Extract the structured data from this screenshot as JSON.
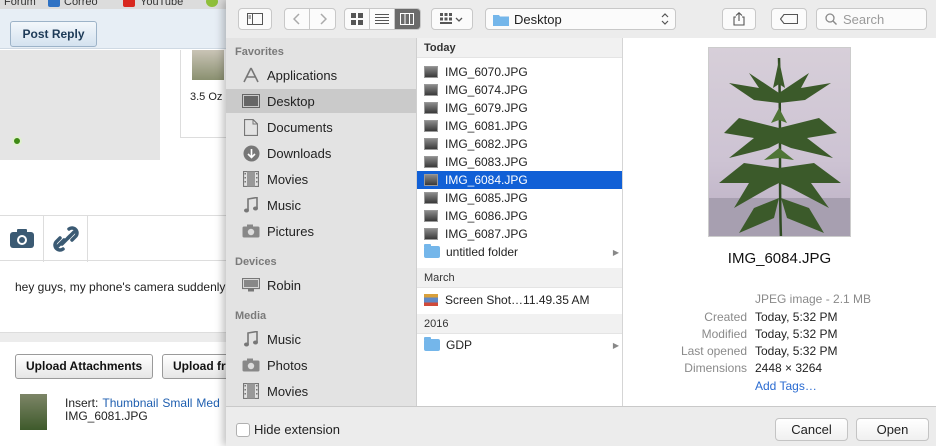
{
  "web": {
    "bookmarks": [
      "Forum",
      "Correo",
      "YouTube"
    ],
    "post_reply_label": "Post Reply",
    "thumb_caption": "3.5 Oz",
    "post_text": "hey guys, my phone's camera suddenly",
    "upload_attachments_label": "Upload Attachments",
    "upload_from_label": "Upload fr",
    "insert_label": "Insert:",
    "insert_links": [
      "Thumbnail",
      "Small",
      "Med"
    ],
    "attachment_name": "IMG_6081.JPG"
  },
  "dialog": {
    "location": "Desktop",
    "search_placeholder": "Search",
    "sidebar": {
      "favorites_header": "Favorites",
      "favorites": [
        {
          "label": "Applications",
          "icon": "applications-icon"
        },
        {
          "label": "Desktop",
          "icon": "desktop-icon",
          "selected": true
        },
        {
          "label": "Documents",
          "icon": "documents-icon"
        },
        {
          "label": "Downloads",
          "icon": "downloads-icon"
        },
        {
          "label": "Movies",
          "icon": "movies-icon"
        },
        {
          "label": "Music",
          "icon": "music-icon"
        },
        {
          "label": "Pictures",
          "icon": "pictures-icon"
        }
      ],
      "devices_header": "Devices",
      "devices": [
        {
          "label": "Robin",
          "icon": "computer-icon"
        }
      ],
      "media_header": "Media",
      "media": [
        {
          "label": "Music",
          "icon": "music-icon"
        },
        {
          "label": "Photos",
          "icon": "photos-icon"
        },
        {
          "label": "Movies",
          "icon": "movies-icon"
        }
      ]
    },
    "column": {
      "today_header": "Today",
      "today_files": [
        "IMG_6070.JPG",
        "IMG_6074.JPG",
        "IMG_6079.JPG",
        "IMG_6081.JPG",
        "IMG_6082.JPG",
        "IMG_6083.JPG",
        "IMG_6084.JPG",
        "IMG_6085.JPG",
        "IMG_6086.JPG",
        "IMG_6087.JPG"
      ],
      "selected_file": "IMG_6084.JPG",
      "today_folder": "untitled folder",
      "march_header": "March",
      "march_file": "Screen Shot…11.49.35 AM",
      "year_header": "2016",
      "year_folder": "GDP"
    },
    "preview": {
      "filename": "IMG_6084.JPG",
      "kind": "JPEG image - 2.1 MB",
      "meta": [
        {
          "key": "Created",
          "value": "Today, 5:32 PM"
        },
        {
          "key": "Modified",
          "value": "Today, 5:32 PM"
        },
        {
          "key": "Last opened",
          "value": "Today, 5:32 PM"
        },
        {
          "key": "Dimensions",
          "value": "2448 × 3264"
        }
      ],
      "add_tags": "Add Tags…"
    },
    "bottom": {
      "hide_extension": "Hide extension",
      "hide_extension_checked": false,
      "cancel": "Cancel",
      "open": "Open"
    },
    "colors": {
      "selection_blue": "#1160d6",
      "folder_blue": "#74b6ea",
      "link_blue": "#2a6bd1"
    }
  }
}
